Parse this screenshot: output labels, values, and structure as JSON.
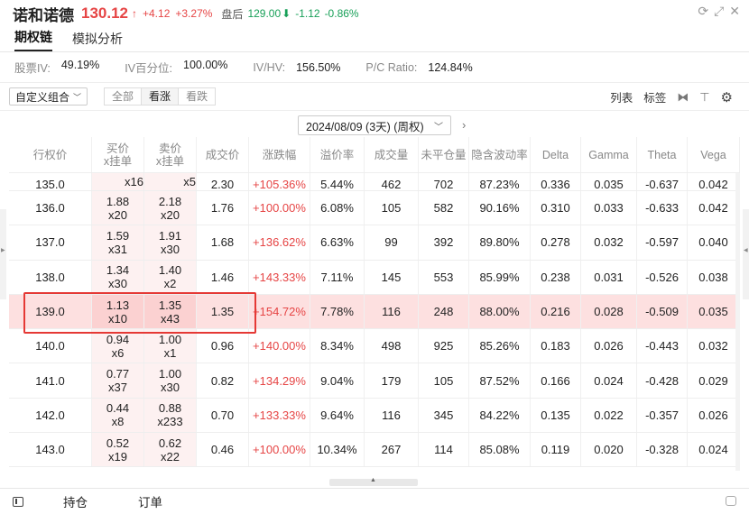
{
  "header": {
    "stock_name": "诺和诺德",
    "price": "130.12",
    "up_arrow": "↑",
    "change": "+4.12",
    "change_pct": "+3.27%",
    "after_hours_label": "盘后",
    "after_hours_price": "129.00",
    "after_hours_arrow": "⬇",
    "after_hours_change": "-1.12",
    "after_hours_pct": "-0.86%",
    "colors": {
      "up": "#e64545",
      "down": "#18a058"
    }
  },
  "tabs": [
    {
      "label": "期权链",
      "active": true
    },
    {
      "label": "模拟分析",
      "active": false
    }
  ],
  "stats": [
    {
      "label": "股票IV:",
      "value": "49.19%"
    },
    {
      "label": "IV百分位:",
      "value": "100.00%"
    },
    {
      "label": "HV/VI:",
      "value": "156.50%",
      "display_label": "IV/HV:"
    },
    {
      "label": "P/C Ratio:",
      "value": "124.84%"
    }
  ],
  "toolbar": {
    "combo_label": "自定义组合",
    "filters": [
      {
        "label": "全部",
        "active": false
      },
      {
        "label": "看涨",
        "active": true
      },
      {
        "label": "看跌",
        "active": false
      }
    ],
    "list_label": "列表",
    "tag_label": "标签"
  },
  "expiry": {
    "selected": "2024/08/09 (3天) (周权)"
  },
  "table": {
    "headers": [
      "行权价",
      "买价\nx挂单",
      "卖价\nx挂单",
      "成交价",
      "涨跌幅",
      "溢价率",
      "成交量",
      "未平仓量",
      "隐含波动率",
      "Delta",
      "Gamma",
      "Theta",
      "Vega"
    ],
    "header_bid_1": "买价",
    "header_bid_2": "x挂单",
    "header_ask_1": "卖价",
    "header_ask_2": "x挂单",
    "partial_row": {
      "strike": "135.0",
      "bid_size": "x16",
      "ask_size": "x5",
      "last": "2.30",
      "chg": "+105.36%",
      "premium": "5.44%",
      "volume": "462",
      "oi": "702",
      "iv": "87.23%",
      "delta": "0.336",
      "gamma": "0.035",
      "theta": "-0.637",
      "vega": "0.042"
    },
    "rows": [
      {
        "strike": "136.0",
        "bid": "1.88",
        "bid_size": "x20",
        "ask": "2.18",
        "ask_size": "x20",
        "last": "1.76",
        "chg": "+100.00%",
        "premium": "6.08%",
        "volume": "105",
        "oi": "582",
        "iv": "90.16%",
        "delta": "0.310",
        "gamma": "0.033",
        "theta": "-0.633",
        "vega": "0.042"
      },
      {
        "strike": "137.0",
        "bid": "1.59",
        "bid_size": "x31",
        "ask": "1.91",
        "ask_size": "x30",
        "last": "1.68",
        "chg": "+136.62%",
        "premium": "6.63%",
        "volume": "99",
        "oi": "392",
        "iv": "89.80%",
        "delta": "0.278",
        "gamma": "0.032",
        "theta": "-0.597",
        "vega": "0.040"
      },
      {
        "strike": "138.0",
        "bid": "1.34",
        "bid_size": "x30",
        "ask": "1.40",
        "ask_size": "x2",
        "last": "1.46",
        "chg": "+143.33%",
        "premium": "7.11%",
        "volume": "145",
        "oi": "553",
        "iv": "85.99%",
        "delta": "0.238",
        "gamma": "0.031",
        "theta": "-0.526",
        "vega": "0.038"
      },
      {
        "strike": "139.0",
        "bid": "1.13",
        "bid_size": "x10",
        "ask": "1.35",
        "ask_size": "x43",
        "last": "1.35",
        "chg": "+154.72%",
        "premium": "7.78%",
        "volume": "116",
        "oi": "248",
        "iv": "88.00%",
        "delta": "0.216",
        "gamma": "0.028",
        "theta": "-0.509",
        "vega": "0.035",
        "highlighted": true
      },
      {
        "strike": "140.0",
        "bid": "0.94",
        "bid_size": "x6",
        "ask": "1.00",
        "ask_size": "x1",
        "last": "0.96",
        "chg": "+140.00%",
        "premium": "8.34%",
        "volume": "498",
        "oi": "925",
        "iv": "85.26%",
        "delta": "0.183",
        "gamma": "0.026",
        "theta": "-0.443",
        "vega": "0.032"
      },
      {
        "strike": "141.0",
        "bid": "0.77",
        "bid_size": "x37",
        "ask": "1.00",
        "ask_size": "x30",
        "last": "0.82",
        "chg": "+134.29%",
        "premium": "9.04%",
        "volume": "179",
        "oi": "105",
        "iv": "87.52%",
        "delta": "0.166",
        "gamma": "0.024",
        "theta": "-0.428",
        "vega": "0.029"
      },
      {
        "strike": "142.0",
        "bid": "0.44",
        "bid_size": "x8",
        "ask": "0.88",
        "ask_size": "x233",
        "last": "0.70",
        "chg": "+133.33%",
        "premium": "9.64%",
        "volume": "116",
        "oi": "345",
        "iv": "84.22%",
        "delta": "0.135",
        "gamma": "0.022",
        "theta": "-0.357",
        "vega": "0.026"
      },
      {
        "strike": "143.0",
        "bid": "0.52",
        "bid_size": "x19",
        "ask": "0.62",
        "ask_size": "x22",
        "last": "0.46",
        "chg": "+100.00%",
        "premium": "10.34%",
        "volume": "267",
        "oi": "114",
        "iv": "85.08%",
        "delta": "0.119",
        "gamma": "0.020",
        "theta": "-0.328",
        "vega": "0.024"
      }
    ]
  },
  "footer": {
    "positions_label": "持仓",
    "orders_label": "订单"
  }
}
